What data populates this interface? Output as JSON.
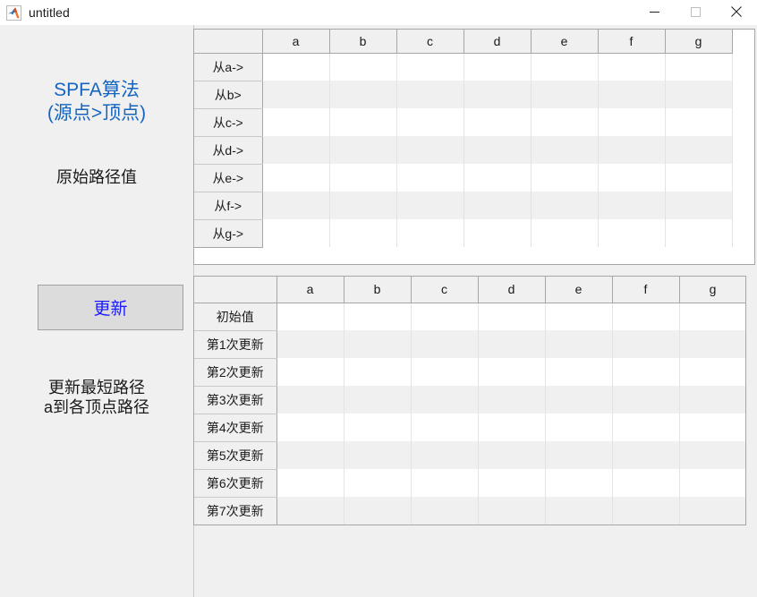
{
  "window": {
    "title": "untitled",
    "icon": "matlab-icon",
    "controls": {
      "minimize": "—",
      "maximize": "□",
      "close": "✕"
    }
  },
  "colors": {
    "accent_blue": "#1565c0",
    "button_text_blue": "#1a1aff",
    "panel_bg": "#f0f0f0",
    "row_stripe": "#f0f0f0",
    "grid_border": "#a6a6a6"
  },
  "sidebar": {
    "title": "SPFA算法\n(源点>顶点)",
    "original_path_label": "原始路径值",
    "update_button_label": "更新",
    "update_description": "更新最短路径\na到各顶点路径"
  },
  "tables": {
    "original_path_table": {
      "corner_label": "",
      "columns": [
        "a",
        "b",
        "c",
        "d",
        "e",
        "f",
        "g"
      ],
      "rows": [
        {
          "label": "从 a->",
          "label_text": "从a->",
          "values": [
            "",
            "",
            "",
            "",
            "",
            "",
            ""
          ]
        },
        {
          "label_text": "从b>",
          "values": [
            "",
            "",
            "",
            "",
            "",
            "",
            ""
          ]
        },
        {
          "label_text": "从c->",
          "values": [
            "",
            "",
            "",
            "",
            "",
            "",
            ""
          ]
        },
        {
          "label_text": "从d->",
          "values": [
            "",
            "",
            "",
            "",
            "",
            "",
            ""
          ]
        },
        {
          "label_text": "从e->",
          "values": [
            "",
            "",
            "",
            "",
            "",
            "",
            ""
          ]
        },
        {
          "label_text": "从f->",
          "values": [
            "",
            "",
            "",
            "",
            "",
            "",
            ""
          ]
        },
        {
          "label_text": "从g->",
          "values": [
            "",
            "",
            "",
            "",
            "",
            "",
            ""
          ]
        }
      ]
    },
    "shortest_path_table": {
      "corner_label": "",
      "columns": [
        "a",
        "b",
        "c",
        "d",
        "e",
        "f",
        "g"
      ],
      "rows": [
        {
          "label_text": "初始值",
          "values": [
            "",
            "",
            "",
            "",
            "",
            "",
            ""
          ]
        },
        {
          "label_text": "第1次更新",
          "values": [
            "",
            "",
            "",
            "",
            "",
            "",
            ""
          ]
        },
        {
          "label_text": "第2次更新",
          "values": [
            "",
            "",
            "",
            "",
            "",
            "",
            ""
          ]
        },
        {
          "label_text": "第3次更新",
          "values": [
            "",
            "",
            "",
            "",
            "",
            "",
            ""
          ]
        },
        {
          "label_text": "第4次更新",
          "values": [
            "",
            "",
            "",
            "",
            "",
            "",
            ""
          ]
        },
        {
          "label_text": "第5次更新",
          "values": [
            "",
            "",
            "",
            "",
            "",
            "",
            ""
          ]
        },
        {
          "label_text": "第6次更新",
          "values": [
            "",
            "",
            "",
            "",
            "",
            "",
            ""
          ]
        },
        {
          "label_text": "第7次更新",
          "values": [
            "",
            "",
            "",
            "",
            "",
            "",
            ""
          ]
        }
      ]
    }
  }
}
